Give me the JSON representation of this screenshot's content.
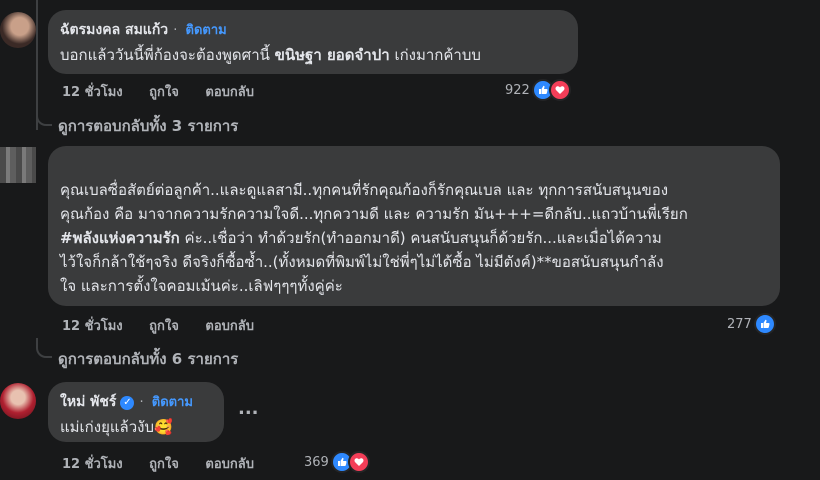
{
  "comments": [
    {
      "name": "ฉัตรมงคล สมแก้ว",
      "follow": "ติดตาม",
      "text_plain": "บอกแล้ววันนี้พี่ก้องจะต้องพูดศานี้ ",
      "text_tag": "ขนิษฐา ยอดจำปา",
      "text_tail": " เก่งมากค้าบบ",
      "time": "12 ชั่วโมง",
      "like": "ถูกใจ",
      "reply": "ตอบกลับ",
      "reaction_count": "922",
      "replies_link": "ดูการตอบกลับทั้ง 3 รายการ"
    },
    {
      "name": "",
      "lines": [
        "คุณเบลซื่อสัตย์ต่อลูกค้า..และดูแลสามี..ทุกคนที่รักคุณก้องก็รักคุณเบล และ ทุกการสนับสนุนของ",
        "คุณก้อง คือ มาจากความรักความใจดี...ทุกความดี และ ความรัก มัน+++=ดีกลับ..แถวบ้านพี่เรียก",
        "#พลังแห่งความรัก ค่ะ..เชื่อว่า ทำด้วยรัก(ทำออกมาดี) คนสนับสนุนก็ด้วยรัก...และเมื่อได้ความ",
        "ไว้ใจก็กล้าใช้ๆจริง ดีจริงก็ซื้อซ้ำ..(ทั้งหมดที่พิมพ์ไม่ใช่พี่ๆไม่ได้ซื้อ ไม่มีตังค์)**ขอสนับสนุนกำลัง",
        "ใจ และการตั้งใจคอมเม้นค่ะ..เลิฟๆๆๆทั้งคู่ค่ะ"
      ],
      "hashtag": "#พลังแห่งความรัก",
      "time": "12 ชั่วโมง",
      "like": "ถูกใจ",
      "reply": "ตอบกลับ",
      "reaction_count": "277",
      "replies_link": "ดูการตอบกลับทั้ง 6 รายการ"
    },
    {
      "name": "ใหม่ พัชร์",
      "follow": "ติดตาม",
      "text": "แม่เก่งยุแล้วงับ🥰",
      "more": "...",
      "time": "12 ชั่วโมง",
      "like": "ถูกใจ",
      "reply": "ตอบกลับ",
      "reaction_count": "369"
    }
  ],
  "icons": {
    "like": "thumbs-up-icon",
    "love": "heart-icon",
    "verified": "verified-badge-icon"
  },
  "colors": {
    "background": "#18191a",
    "bubble": "#3a3b3c",
    "link": "#4599ff",
    "like_blue": "#2e89ff",
    "love_red": "#f33e58"
  }
}
